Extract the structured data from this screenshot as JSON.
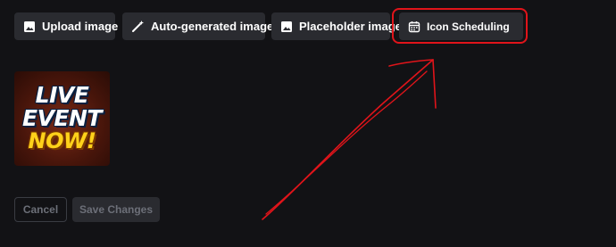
{
  "toolbar": {
    "upload_label": "Upload image",
    "autogen_label": "Auto-generated image",
    "placeholder_label": "Placeholder image",
    "scheduling_label": "Icon Scheduling"
  },
  "preview": {
    "line1": "LIVE",
    "line2": "EVENT",
    "line3": "NOW!"
  },
  "actions": {
    "cancel_label": "Cancel",
    "save_label": "Save Changes"
  },
  "colors": {
    "background": "#121215",
    "button": "#2a2b30",
    "annotation": "#e0141a"
  },
  "icons": [
    "image-icon",
    "magic-wand-icon",
    "image-icon",
    "calendar-icon"
  ]
}
